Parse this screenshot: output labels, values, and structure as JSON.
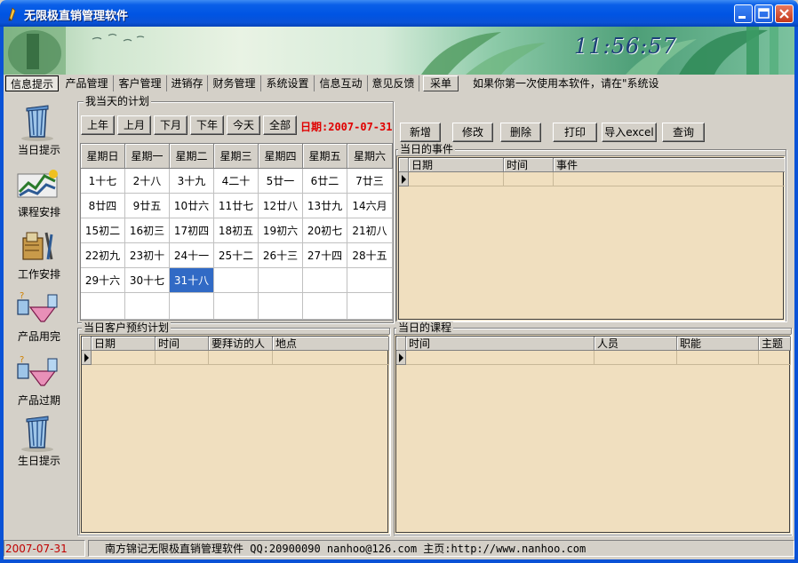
{
  "window": {
    "title": "无限极直销管理软件"
  },
  "banner": {
    "clock": "11:56:57"
  },
  "menu": {
    "items": [
      "信息提示",
      "产品管理",
      "客户管理",
      "进销存",
      "财务管理",
      "系统设置",
      "信息互动",
      "意见反馈"
    ],
    "button": "采单",
    "marquee": "如果你第一次使用本软件，请在\"系统设"
  },
  "leftnav": [
    {
      "label": "当日提示",
      "icon": "trash-bin-icon"
    },
    {
      "label": "课程安排",
      "icon": "line-chart-icon"
    },
    {
      "label": "工作安排",
      "icon": "tools-icon"
    },
    {
      "label": "产品用完",
      "icon": "funnel-flask-icon"
    },
    {
      "label": "产品过期",
      "icon": "funnel-flask-icon"
    },
    {
      "label": "生日提示",
      "icon": "trash-bin-icon"
    }
  ],
  "plan": {
    "title": "我当天的计划",
    "nav_buttons": [
      "上年",
      "上月",
      "下月",
      "下年",
      "今天",
      "全部"
    ],
    "date_label": "日期:2007-07-31",
    "action_buttons": [
      "新增",
      "修改",
      "删除",
      "打印",
      "导入excel",
      "查询"
    ]
  },
  "calendar": {
    "weekdays": [
      "星期日",
      "星期一",
      "星期二",
      "星期三",
      "星期四",
      "星期五",
      "星期六"
    ],
    "rows": [
      [
        "1十七",
        "2十八",
        "3十九",
        "4二十",
        "5廿一",
        "6廿二",
        "7廿三"
      ],
      [
        "8廿四",
        "9廿五",
        "10廿六",
        "11廿七",
        "12廿八",
        "13廿九",
        "14六月"
      ],
      [
        "15初二",
        "16初三",
        "17初四",
        "18初五",
        "19初六",
        "20初七",
        "21初八"
      ],
      [
        "22初九",
        "23初十",
        "24十一",
        "25十二",
        "26十三",
        "27十四",
        "28十五"
      ],
      [
        "29十六",
        "30十七",
        "31十八",
        "",
        "",
        "",
        ""
      ],
      [
        "",
        "",
        "",
        "",
        "",
        "",
        ""
      ]
    ],
    "selected": "31十八"
  },
  "events": {
    "title": "当日的事件",
    "columns": [
      "日期",
      "时间",
      "事件"
    ]
  },
  "appointments": {
    "title": "当日客户预约计划",
    "columns": [
      "日期",
      "时间",
      "要拜访的人",
      "地点"
    ]
  },
  "courses": {
    "title": "当日的课程",
    "columns": [
      "时间",
      "人员",
      "职能",
      "主题"
    ]
  },
  "status": {
    "date": "2007-07-31",
    "info": "南方锦记无限极直销管理软件 QQ:20900090 nanhoo@126.com 主页:http://www.nanhoo.com"
  },
  "colors": {
    "titlebar": "#0054e3",
    "grid_bg": "#f0dfbf",
    "date_red": "#e00000",
    "selected": "#316ac5"
  }
}
